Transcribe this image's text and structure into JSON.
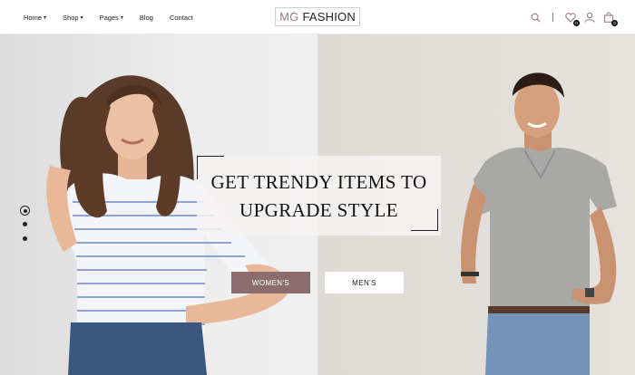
{
  "nav": {
    "items": [
      {
        "label": "Home",
        "has_dropdown": true
      },
      {
        "label": "Shop",
        "has_dropdown": true
      },
      {
        "label": "Pages",
        "has_dropdown": true
      },
      {
        "label": "Blog",
        "has_dropdown": false
      },
      {
        "label": "Contact",
        "has_dropdown": false
      }
    ],
    "caret": "▾"
  },
  "logo": {
    "prefix": "MG",
    "name": "FASHION",
    "prefix_color": "#9a7c7f"
  },
  "header_icons": {
    "search": "search-icon",
    "wishlist": "heart-icon",
    "wishlist_count": "0",
    "account": "user-icon",
    "cart": "cart-icon",
    "cart_count": "0"
  },
  "hero": {
    "headline_line1": "GET TRENDY ITEMS TO",
    "headline_line2": "UPGRADE STYLE",
    "women_button": "WOMEN'S",
    "men_button": "MEN'S",
    "accent_color": "#8b6d70",
    "slides_total": 3,
    "active_slide": 1
  }
}
